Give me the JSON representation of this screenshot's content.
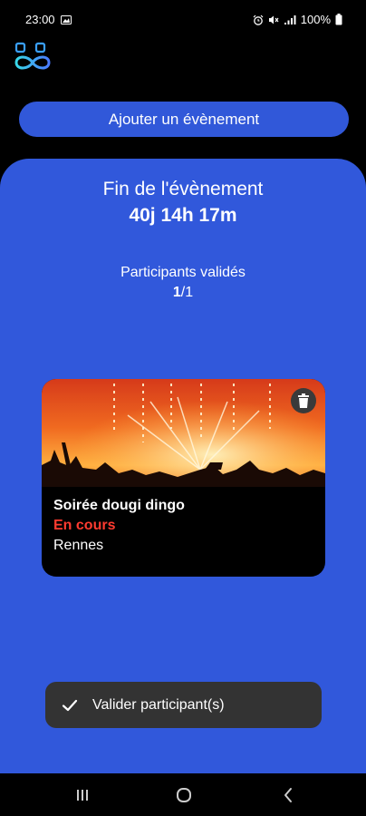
{
  "status_bar": {
    "time": "23:00",
    "battery": "100%"
  },
  "header": {
    "add_event_label": "Ajouter un évènement"
  },
  "event_timer": {
    "title": "Fin de l'évènement",
    "countdown": "40j 14h 17m"
  },
  "participants": {
    "label": "Participants validés",
    "validated": "1",
    "total": "/1"
  },
  "event_card": {
    "name": "Soirée dougi dingo",
    "status": "En cours",
    "city": "Rennes",
    "status_color": "#ff3b30"
  },
  "actions": {
    "validate_label": "Valider participant(s)"
  },
  "colors": {
    "accent": "#3158db",
    "background": "#000000",
    "snackbar": "#333333"
  },
  "icons": [
    "logo-icon",
    "trash-icon",
    "check-icon",
    "recents-icon",
    "home-icon",
    "back-icon"
  ]
}
